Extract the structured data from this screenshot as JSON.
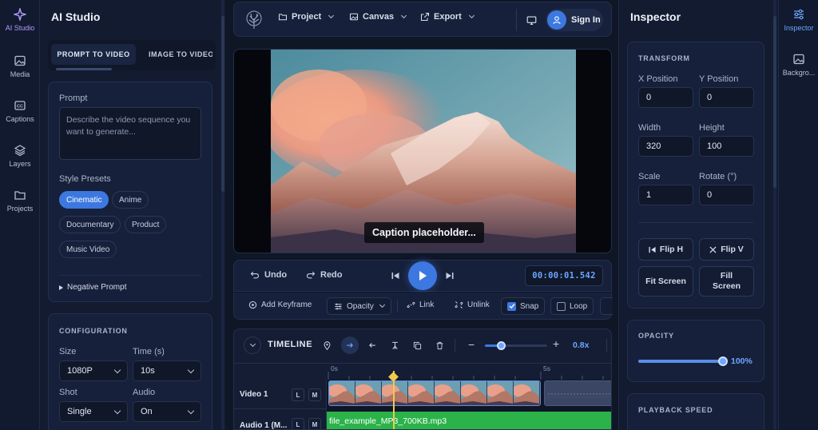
{
  "rail": {
    "items": [
      {
        "label": "AI Studio"
      },
      {
        "label": "Media"
      },
      {
        "label": "Captions"
      },
      {
        "label": "Layers"
      },
      {
        "label": "Projects"
      }
    ]
  },
  "ai_studio": {
    "title": "AI Studio",
    "tabs": [
      "PROMPT TO VIDEO",
      "IMAGE TO VIDEO"
    ],
    "prompt_label": "Prompt",
    "prompt_placeholder": "Describe the video sequence you want to generate...",
    "style_presets_label": "Style Presets",
    "presets": [
      "Cinematic",
      "Anime",
      "Documentary",
      "Product",
      "Music Video"
    ],
    "selected_preset": "Cinematic",
    "negative_prompt": "Negative Prompt",
    "configuration_title": "CONFIGURATION",
    "size_label": "Size",
    "size_value": "1080P",
    "time_label": "Time (s)",
    "time_value": "10s",
    "shot_label": "Shot",
    "shot_value": "Single",
    "audio_label": "Audio",
    "audio_value": "On"
  },
  "topbar": {
    "project": "Project",
    "canvas": "Canvas",
    "export": "Export",
    "sign_in": "Sign In"
  },
  "preview": {
    "caption": "Caption placeholder..."
  },
  "controls": {
    "undo": "Undo",
    "redo": "Redo",
    "timecode": "00:00:01.542"
  },
  "toolbar": {
    "add_keyframe": "Add Keyframe",
    "opacity": "Opacity",
    "link": "Link",
    "unlink": "Unlink",
    "snap": "Snap",
    "loop": "Loop",
    "snap_checked": true,
    "loop_checked": false
  },
  "timeline": {
    "title": "TIMELINE",
    "zoom": "0.8x",
    "zoom_level": 0.25,
    "ruler": [
      "0s",
      "5s"
    ],
    "tracks": [
      {
        "name": "Video 1",
        "l": "L",
        "m": "M"
      },
      {
        "name": "Audio 1 (M...",
        "l": "L",
        "m": "M",
        "clip": "file_example_MP3_700KB.mp3"
      }
    ]
  },
  "inspector": {
    "title": "Inspector",
    "transform_title": "TRANSFORM",
    "x_label": "X Position",
    "x_value": "0",
    "y_label": "Y Position",
    "y_value": "0",
    "width_label": "Width",
    "width_value": "320",
    "height_label": "Height",
    "height_value": "100",
    "scale_label": "Scale",
    "scale_value": "1",
    "rotate_label": "Rotate (°)",
    "rotate_value": "0",
    "flip_h": "Flip H",
    "flip_v": "Flip V",
    "fit_screen": "Fit Screen",
    "fill_screen": "Fill Screen",
    "opacity_title": "OPACITY",
    "opacity_value": "100%",
    "opacity_level": 1.0,
    "playback_title": "PLAYBACK SPEED"
  },
  "right_rail": {
    "items": [
      {
        "label": "Inspector"
      },
      {
        "label": "Backgro..."
      }
    ]
  },
  "colors": {
    "accent": "#3d78e0",
    "rail_active": "#b59cff",
    "audio_clip": "#2bb34a"
  }
}
